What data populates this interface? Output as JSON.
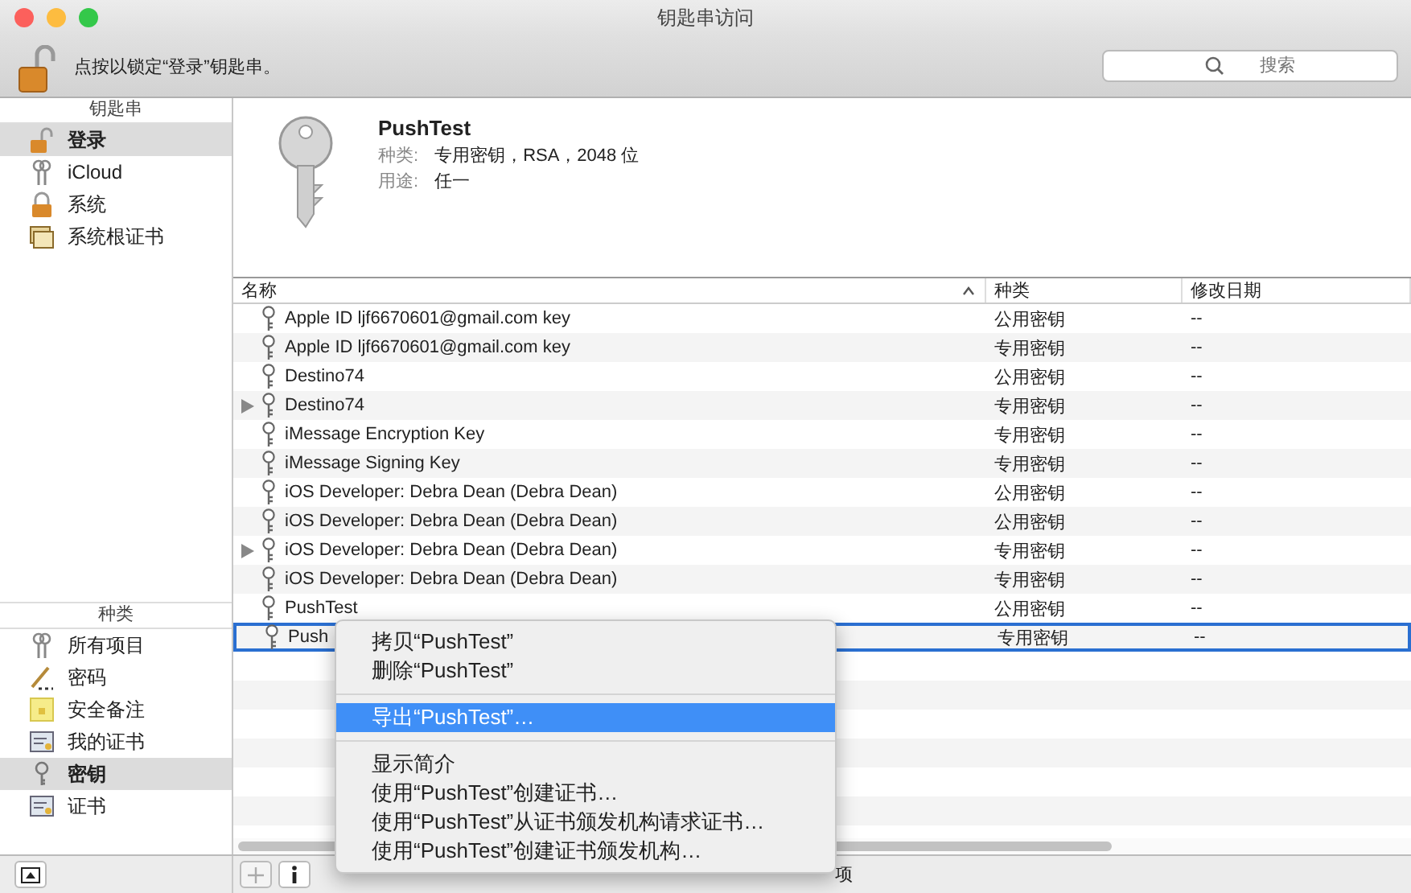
{
  "window": {
    "title": "钥匙串访问"
  },
  "toolbar": {
    "lock_text": "点按以锁定“登录”钥匙串。",
    "search": {
      "placeholder": "搜索"
    }
  },
  "sidebar": {
    "keychains": {
      "header": "钥匙串",
      "items": [
        {
          "label": "登录",
          "kind": "unlocked",
          "selected": true
        },
        {
          "label": "iCloud",
          "kind": "keys",
          "selected": false
        },
        {
          "label": "系统",
          "kind": "locked",
          "selected": false
        },
        {
          "label": "系统根证书",
          "kind": "certs",
          "selected": false
        }
      ]
    },
    "categories": {
      "header": "种类",
      "items": [
        {
          "label": "所有项目",
          "kind": "keys",
          "selected": false
        },
        {
          "label": "密码",
          "kind": "pen",
          "selected": false
        },
        {
          "label": "安全备注",
          "kind": "note",
          "selected": false
        },
        {
          "label": "我的证书",
          "kind": "cert",
          "selected": false
        },
        {
          "label": "密钥",
          "kind": "key",
          "selected": true
        },
        {
          "label": "证书",
          "kind": "cert",
          "selected": false
        }
      ]
    }
  },
  "detail": {
    "name": "PushTest",
    "fields": [
      {
        "label": "种类:",
        "value": "专用密钥，RSA，2048 位"
      },
      {
        "label": "用途:",
        "value": "任一"
      }
    ]
  },
  "table": {
    "columns": [
      "名称",
      "种类",
      "修改日期"
    ],
    "rows": [
      {
        "name": "Apple ID ljf6670601@gmail.com key",
        "kind": "公用密钥",
        "date": "--",
        "selected": false
      },
      {
        "name": "Apple ID ljf6670601@gmail.com key",
        "kind": "专用密钥",
        "date": "--",
        "selected": false
      },
      {
        "name": "Destino74",
        "kind": "公用密钥",
        "date": "--",
        "selected": false
      },
      {
        "name": "Destino74",
        "kind": "专用密钥",
        "date": "--",
        "selected": false,
        "expanded": false
      },
      {
        "name": "iMessage Encryption Key",
        "kind": "专用密钥",
        "date": "--",
        "selected": false
      },
      {
        "name": "iMessage Signing Key",
        "kind": "专用密钥",
        "date": "--",
        "selected": false
      },
      {
        "name": "iOS Developer: Debra Dean (Debra Dean)",
        "kind": "公用密钥",
        "date": "--",
        "selected": false
      },
      {
        "name": "iOS Developer: Debra Dean (Debra Dean)",
        "kind": "公用密钥",
        "date": "--",
        "selected": false
      },
      {
        "name": "iOS Developer: Debra Dean (Debra Dean)",
        "kind": "专用密钥",
        "date": "--",
        "selected": false,
        "expanded": false
      },
      {
        "name": "iOS Developer: Debra Dean (Debra Dean)",
        "kind": "专用密钥",
        "date": "--",
        "selected": false
      },
      {
        "name": "PushTest",
        "kind": "公用密钥",
        "date": "--",
        "selected": false
      },
      {
        "name": "Push",
        "kind": "专用密钥",
        "date": "--",
        "selected": true
      }
    ]
  },
  "context_menu": {
    "groups": [
      [
        {
          "label": "拷贝“PushTest”",
          "selected": false
        },
        {
          "label": "删除“PushTest”",
          "selected": false
        }
      ],
      [
        {
          "label": "导出“PushTest”…",
          "selected": true
        }
      ],
      [
        {
          "label": "显示简介",
          "selected": false
        },
        {
          "label": "使用“PushTest”创建证书…",
          "selected": false
        },
        {
          "label": "使用“PushTest”从证书颁发机构请求证书…",
          "selected": false
        },
        {
          "label": "使用“PushTest”创建证书颁发机构…",
          "selected": false
        }
      ]
    ]
  },
  "status_bar": {
    "text": "项"
  }
}
